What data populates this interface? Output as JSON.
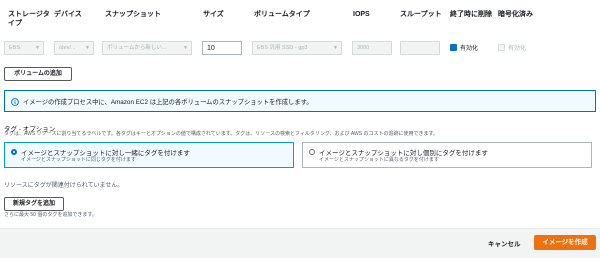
{
  "headers": {
    "storage_type": "ストレージタ\nイプ",
    "device": "デバイス",
    "snapshot": "スナップショット",
    "size": "サイズ",
    "volume_type": "ボリュームタイプ",
    "iops": "IOPS",
    "throughput": "スループット",
    "delete_on_termination": "終了時に削除",
    "encrypted": "暗号化済み"
  },
  "row": {
    "storage_type": "EBS",
    "device": "/dev/...",
    "snapshot": "ボリュームから新しい...",
    "size": "10",
    "volume_type": "EBS 汎用 SSD - gp3",
    "iops": "3000",
    "throughput": "",
    "delete_on_termination_label": "有効化",
    "delete_on_termination_checked": true,
    "encrypted_label": "有効化",
    "encrypted_checked": false
  },
  "add_volume_button": "ボリュームの追加",
  "info_message": "イメージの作成プロセス中に、Amazon EC2 は上記の各ボリュームのスナップショットを作成します。",
  "tags": {
    "title": "タグ - オプション",
    "description": "タグは、AWS リソースに割り当てるラベルです。各タグはキーとオプションの値で構成されています。タグは、リソースの検索とフィルタリング、および AWS のコストの追跡に使用できます。",
    "option_together_title": "イメージとスナップショットに対し一緒にタグを付けます",
    "option_together_desc": "イメージとスナップショットに同じタグを付けます",
    "option_separate_title": "イメージとスナップショットに対し個別にタグを付けます",
    "option_separate_desc": "イメージとスナップショットに異なるタグを付けます",
    "selected": "together",
    "empty_text": "リソースにタグが関連付けられていません。",
    "add_tag_button": "新規タグを追加",
    "limit_text": "さらに最大 50 個のタグを追加できます。"
  },
  "footer": {
    "cancel": "キャンセル",
    "create": "イメージを作成"
  },
  "colors": {
    "accent": "#0073bb",
    "primary_button": "#ec7211",
    "info_bg": "#f1faff"
  }
}
